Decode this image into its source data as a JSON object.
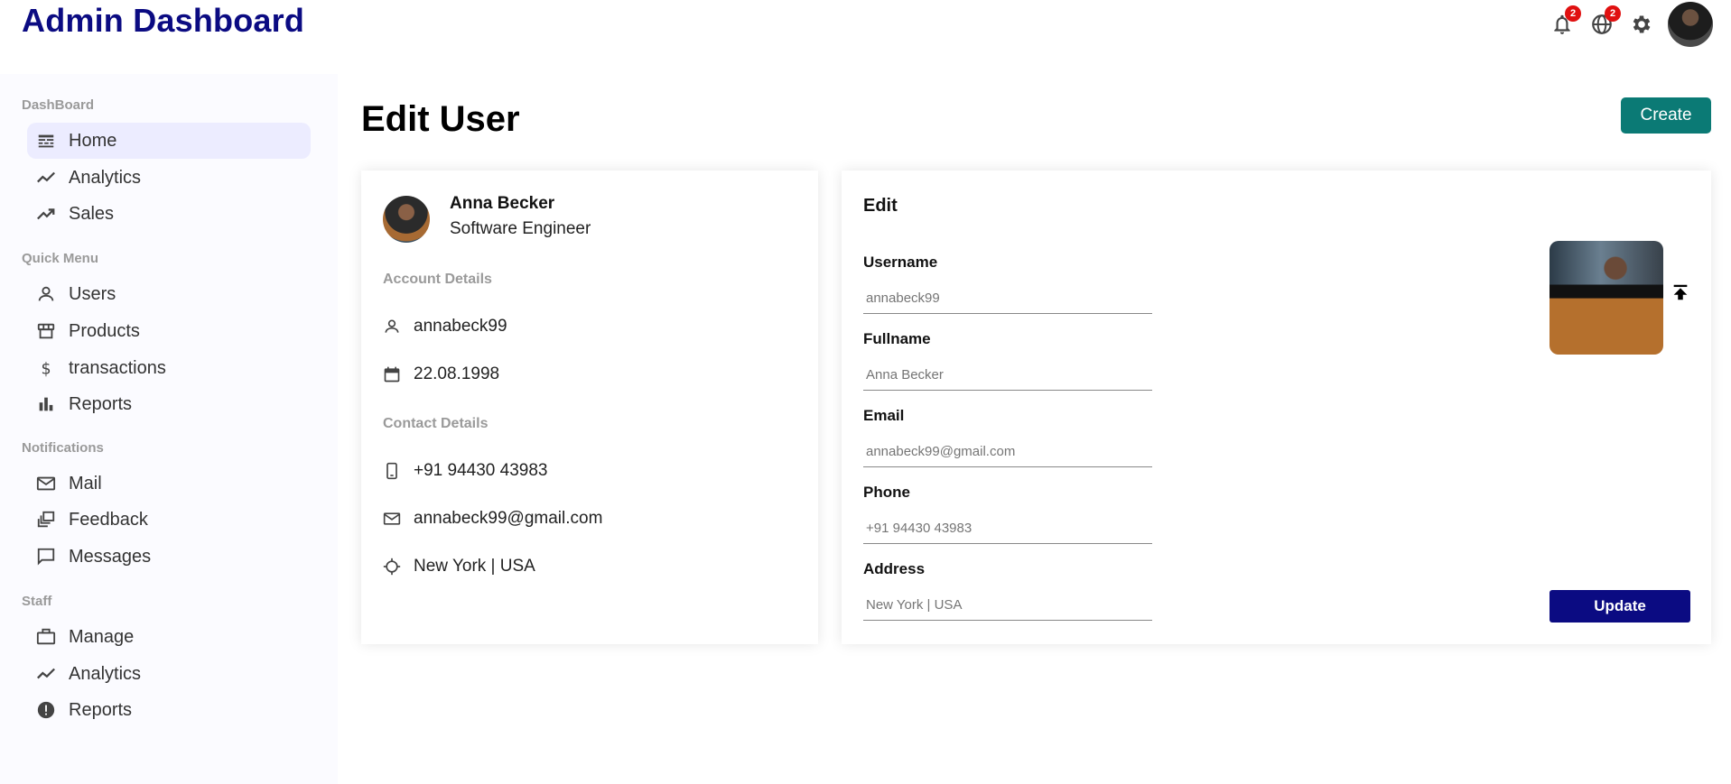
{
  "app": {
    "title": "Admin Dashboard"
  },
  "topbar": {
    "notifications_badge": "2",
    "language_badge": "2"
  },
  "sidebar": {
    "sections": [
      {
        "title": "DashBoard",
        "items": [
          {
            "label": "Home",
            "icon": "dashboard-icon",
            "active": true
          },
          {
            "label": "Analytics",
            "icon": "timeline-icon"
          },
          {
            "label": "Sales",
            "icon": "trending-up-icon"
          }
        ]
      },
      {
        "title": "Quick Menu",
        "items": [
          {
            "label": "Users",
            "icon": "person-icon"
          },
          {
            "label": "Products",
            "icon": "storefront-icon"
          },
          {
            "label": "transactions",
            "icon": "dollar-icon"
          },
          {
            "label": "Reports",
            "icon": "bar-chart-icon"
          }
        ]
      },
      {
        "title": "Notifications",
        "items": [
          {
            "label": "Mail",
            "icon": "mail-icon"
          },
          {
            "label": "Feedback",
            "icon": "dynamic-feed-icon"
          },
          {
            "label": "Messages",
            "icon": "chat-bubble-icon"
          }
        ]
      },
      {
        "title": "Staff",
        "items": [
          {
            "label": "Manage",
            "icon": "briefcase-icon"
          },
          {
            "label": "Analytics",
            "icon": "timeline-icon"
          },
          {
            "label": "Reports",
            "icon": "report-icon"
          }
        ]
      }
    ]
  },
  "main": {
    "title": "Edit User",
    "create_label": "Create"
  },
  "user_card": {
    "name": "Anna Becker",
    "role": "Software Engineer",
    "account_title": "Account Details",
    "username": "annabeck99",
    "birthday": "22.08.1998",
    "contact_title": "Contact Details",
    "phone": "+91 94430 43983",
    "email": "annabeck99@gmail.com",
    "location": "New York | USA"
  },
  "edit_form": {
    "title": "Edit",
    "fields": [
      {
        "label": "Username",
        "placeholder": "annabeck99"
      },
      {
        "label": "Fullname",
        "placeholder": "Anna Becker"
      },
      {
        "label": "Email",
        "placeholder": "annabeck99@gmail.com"
      },
      {
        "label": "Phone",
        "placeholder": "+91 94430 43983"
      },
      {
        "label": "Address",
        "placeholder": "New York | USA"
      }
    ],
    "update_label": "Update"
  },
  "colors": {
    "brand": "#0b0b82",
    "create_button": "#0b7a75",
    "active_item_bg": "#ececff",
    "badge": "#e01010"
  }
}
